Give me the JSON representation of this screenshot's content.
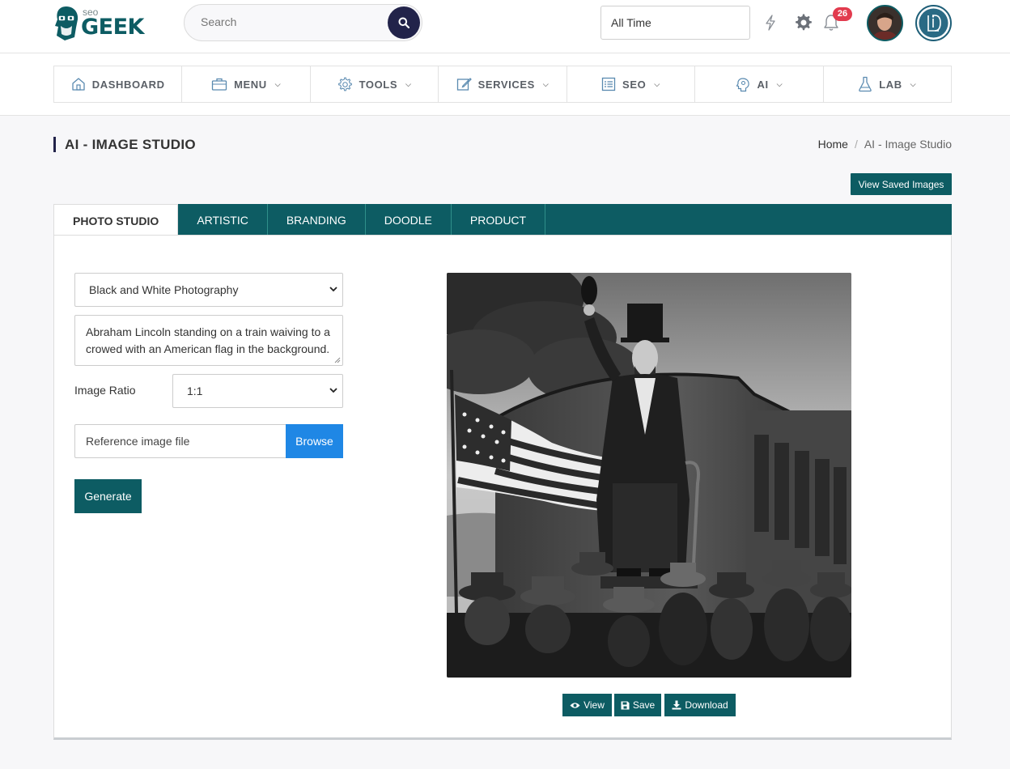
{
  "header": {
    "logo_small": "seo",
    "logo_main": "GEEK",
    "search_placeholder": "Search",
    "time_filter": "All Time",
    "notification_count": "26"
  },
  "nav": {
    "items": [
      {
        "label": "DASHBOARD",
        "icon": "home-icon",
        "dropdown": false
      },
      {
        "label": "MENU",
        "icon": "briefcase-icon",
        "dropdown": true
      },
      {
        "label": "TOOLS",
        "icon": "gear-icon",
        "dropdown": true
      },
      {
        "label": "SERVICES",
        "icon": "edit-icon",
        "dropdown": true
      },
      {
        "label": "SEO",
        "icon": "list-icon",
        "dropdown": true
      },
      {
        "label": "AI",
        "icon": "brain-icon",
        "dropdown": true
      },
      {
        "label": "LAB",
        "icon": "flask-icon",
        "dropdown": true
      }
    ]
  },
  "page": {
    "title": "AI - IMAGE STUDIO",
    "breadcrumb_home": "Home",
    "breadcrumb_current": "AI - Image Studio",
    "view_saved": "View Saved Images"
  },
  "tabs": [
    "PHOTO STUDIO",
    "ARTISTIC",
    "BRANDING",
    "DOODLE",
    "PRODUCT"
  ],
  "form": {
    "style_value": "Black and White Photography",
    "prompt_value": "Abraham Lincoln standing on a train waiving to a crowed with an American flag in the background.",
    "ratio_label": "Image Ratio",
    "ratio_value": "1:1",
    "file_placeholder": "Reference image file",
    "browse_label": "Browse",
    "generate_label": "Generate"
  },
  "actions": {
    "view": "View",
    "save": "Save",
    "download": "Download"
  },
  "colors": {
    "primary": "#0d5c63",
    "accent_blue": "#1f87e5",
    "badge_red": "#e23b4e",
    "dark_navy": "#22234a"
  }
}
